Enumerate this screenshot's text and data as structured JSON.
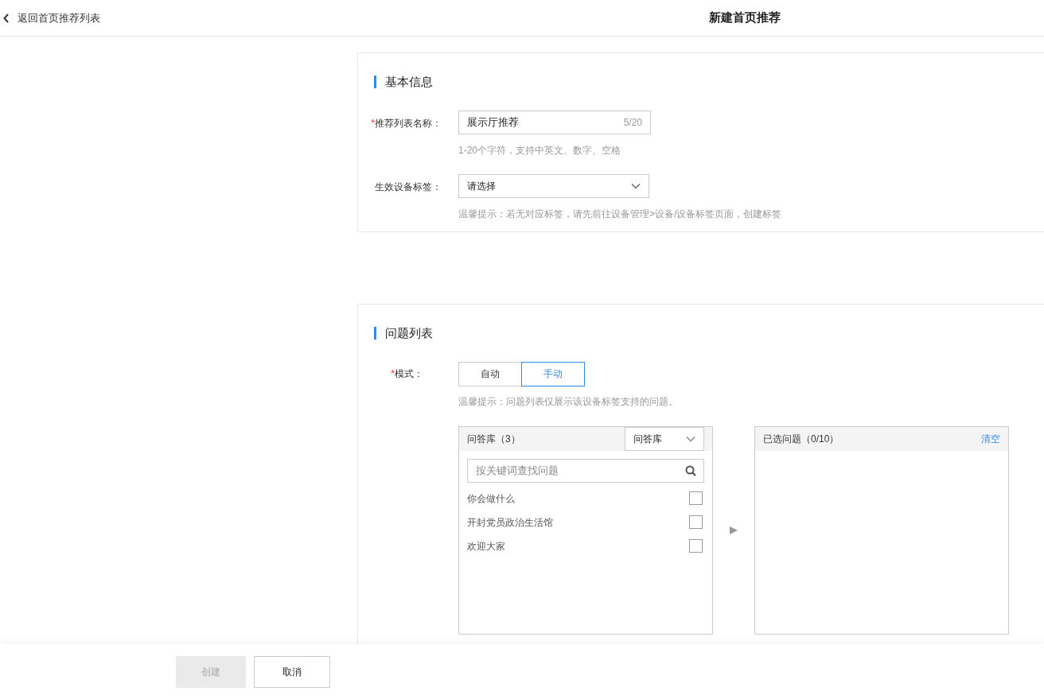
{
  "header": {
    "back_link": "返回首页推荐列表",
    "title": "新建首页推荐"
  },
  "basic_info": {
    "title": "基本信息",
    "name_field": {
      "label": "推荐列表名称：",
      "required_mark": "*",
      "value": "展示厅推荐",
      "counter": "5/20",
      "hint": "1-20个字符，支持中英文、数字、空格"
    },
    "tag_field": {
      "label": "生效设备标签：",
      "placeholder": "请选择",
      "hint": "温馨提示：若无对应标签，请先前往设备管理>设备/设备标签页面，创建标签"
    }
  },
  "question_list": {
    "title": "问题列表",
    "mode": {
      "label": "模式：",
      "required_mark": "*",
      "options": [
        {
          "label": "自动",
          "selected": false
        },
        {
          "label": "手动",
          "selected": true
        }
      ],
      "hint": "温馨提示：问题列表仅展示该设备标签支持的问题。"
    },
    "source": {
      "title": "问答库（3）",
      "dropdown": "问答库",
      "search_placeholder": "按关键词查找问题",
      "items": [
        {
          "label": "你会做什么",
          "checked": false
        },
        {
          "label": "开封党员政治生活馆",
          "checked": false
        },
        {
          "label": "欢迎大家",
          "checked": false
        }
      ]
    },
    "selected": {
      "title": "已选问题（0/10）",
      "clear": "清空"
    }
  },
  "footer": {
    "buttons": [
      {
        "label": "创建",
        "disabled": true
      },
      {
        "label": "取消",
        "disabled": false
      }
    ]
  }
}
